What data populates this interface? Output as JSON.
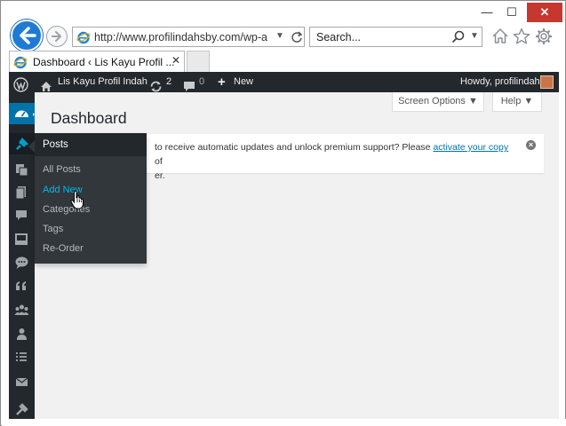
{
  "browser": {
    "window_controls": {
      "minimize": "—",
      "maximize": "☐",
      "close": "✕"
    },
    "address": {
      "url": "http://www.profilindahsby.com/wp-a"
    },
    "search": {
      "placeholder": "Search..."
    },
    "tab": {
      "title": "Dashboard ‹ Lis Kayu Profil ...",
      "close": "✕"
    }
  },
  "adminbar": {
    "site_name": "Lis Kayu Profil Indah",
    "updates_count": "2",
    "comments_count": "0",
    "new_plus": "+",
    "new_label": "New",
    "howdy": "Howdy, profilindah"
  },
  "header": {
    "screen_options": "Screen Options ▼",
    "help": "Help ▼",
    "page_title": "Dashboard"
  },
  "notice": {
    "line1_before": "to receive automatic updates and unlock premium support? Please ",
    "link_text": "activate your copy",
    "line1_after": " of",
    "line2": "er.",
    "dismiss": "×"
  },
  "posts_menu": {
    "title": "Posts",
    "items": [
      "All Posts",
      "Add New",
      "Categories",
      "Tags",
      "Re-Order"
    ]
  },
  "sidebar_icons": [
    "dashboard-icon",
    "pin-icon",
    "media-icon",
    "pages-icon",
    "comments-icon",
    "portfolio-icon",
    "chat-icon",
    "quote-icon",
    "groups-icon",
    "users-icon",
    "list-icon",
    "mail-icon",
    "tools-icon"
  ],
  "colors": {
    "adminbar": "#23282d",
    "sidebar_active": "#0073aa",
    "link": "#0073aa",
    "menu_current": "#00b9eb",
    "notice_border": "#00a0d2",
    "ie_back": "#1f7ad6",
    "close_button": "#c7372e"
  }
}
